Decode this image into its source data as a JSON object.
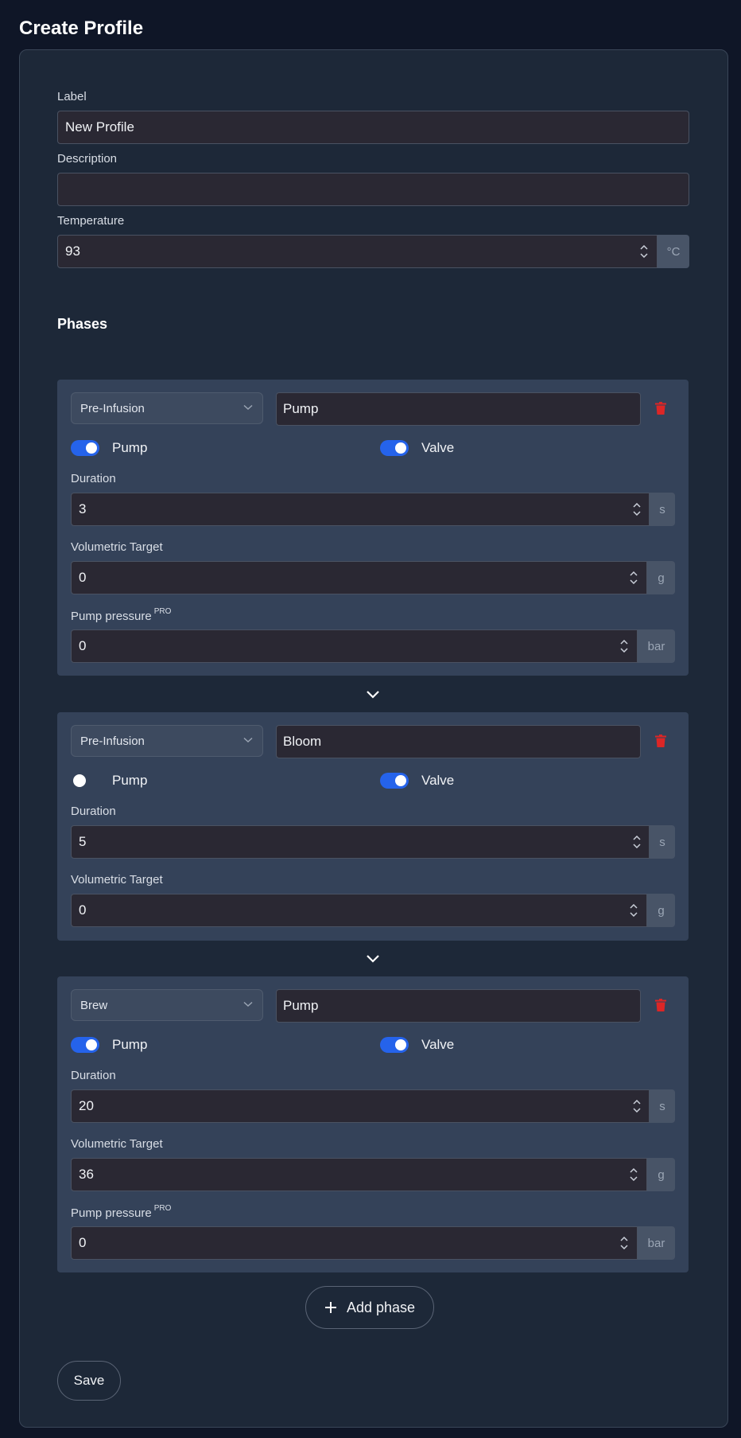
{
  "page": {
    "title": "Create Profile"
  },
  "form": {
    "label": {
      "label": "Label",
      "value": "New Profile"
    },
    "description": {
      "label": "Description",
      "value": ""
    },
    "temperature": {
      "label": "Temperature",
      "value": "93",
      "unit": "°C"
    }
  },
  "phases_title": "Phases",
  "phases": [
    {
      "type": "Pre-Infusion",
      "name": "Pump",
      "pump_label": "Pump",
      "pump_on": true,
      "valve_label": "Valve",
      "valve_on": true,
      "duration": {
        "label": "Duration",
        "value": "3",
        "unit": "s"
      },
      "volumetric": {
        "label": "Volumetric Target",
        "value": "0",
        "unit": "g"
      },
      "pressure": {
        "label": "Pump pressure",
        "badge": "PRO",
        "value": "0",
        "unit": "bar"
      }
    },
    {
      "type": "Pre-Infusion",
      "name": "Bloom",
      "pump_label": "Pump",
      "pump_on": false,
      "valve_label": "Valve",
      "valve_on": true,
      "duration": {
        "label": "Duration",
        "value": "5",
        "unit": "s"
      },
      "volumetric": {
        "label": "Volumetric Target",
        "value": "0",
        "unit": "g"
      }
    },
    {
      "type": "Brew",
      "name": "Pump",
      "pump_label": "Pump",
      "pump_on": true,
      "valve_label": "Valve",
      "valve_on": true,
      "duration": {
        "label": "Duration",
        "value": "20",
        "unit": "s"
      },
      "volumetric": {
        "label": "Volumetric Target",
        "value": "36",
        "unit": "g"
      },
      "pressure": {
        "label": "Pump pressure",
        "badge": "PRO",
        "value": "0",
        "unit": "bar"
      }
    }
  ],
  "buttons": {
    "add_phase": "Add phase",
    "save": "Save"
  },
  "colors": {
    "accent": "#2563eb",
    "danger": "#dc2626",
    "background": "#0f1627",
    "card": "#1d2838",
    "phase": "#344259"
  },
  "icons": {
    "delete": "trash-icon",
    "add": "plus-icon",
    "next": "chevron-down-icon",
    "select": "chevron-down-icon",
    "spin": "spinner-icon"
  }
}
